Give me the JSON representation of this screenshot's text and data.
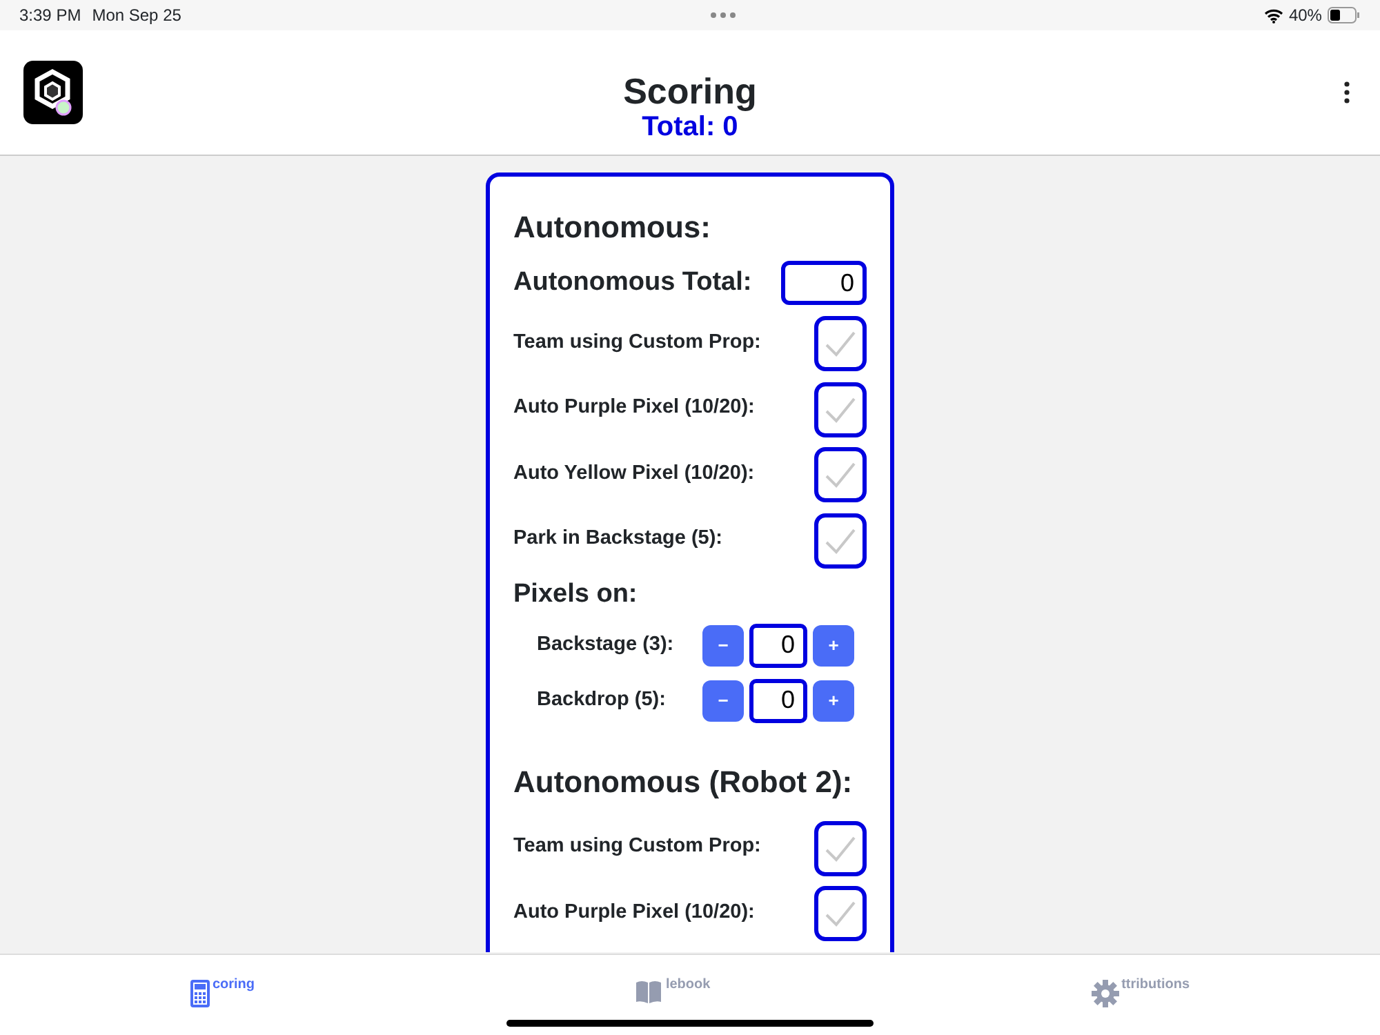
{
  "status_bar": {
    "time": "3:39 PM",
    "date": "Mon Sep 25",
    "battery": "40%"
  },
  "header": {
    "title": "Scoring",
    "total": "Total: 0"
  },
  "sections": [
    {
      "title": "Autonomous:",
      "items": [
        {
          "kind": "total",
          "label": "Autonomous Total:",
          "value": "0"
        },
        {
          "kind": "checkbox",
          "label": "Team using Custom Prop:",
          "checked": false
        },
        {
          "kind": "checkbox",
          "label": "Auto Purple Pixel (10/20):",
          "checked": false
        },
        {
          "kind": "checkbox",
          "label": "Auto Yellow Pixel (10/20):",
          "checked": false
        },
        {
          "kind": "checkbox",
          "label": "Park in Backstage (5):",
          "checked": false
        },
        {
          "kind": "subheading",
          "label": "Pixels on:"
        },
        {
          "kind": "stepper",
          "label": "Backstage (3):",
          "value": "0",
          "minus": "−",
          "plus": "+"
        },
        {
          "kind": "stepper",
          "label": "Backdrop (5):",
          "value": "0",
          "minus": "−",
          "plus": "+"
        }
      ]
    },
    {
      "title": "Autonomous (Robot 2):",
      "items": [
        {
          "kind": "checkbox",
          "label": "Team using Custom Prop:",
          "checked": false
        },
        {
          "kind": "checkbox",
          "label": "Auto Purple Pixel (10/20):",
          "checked": false
        }
      ]
    }
  ],
  "tabs": [
    {
      "label": "coring",
      "selected": true
    },
    {
      "label": "lebook",
      "selected": false
    },
    {
      "label": "ttributions",
      "selected": false
    }
  ]
}
